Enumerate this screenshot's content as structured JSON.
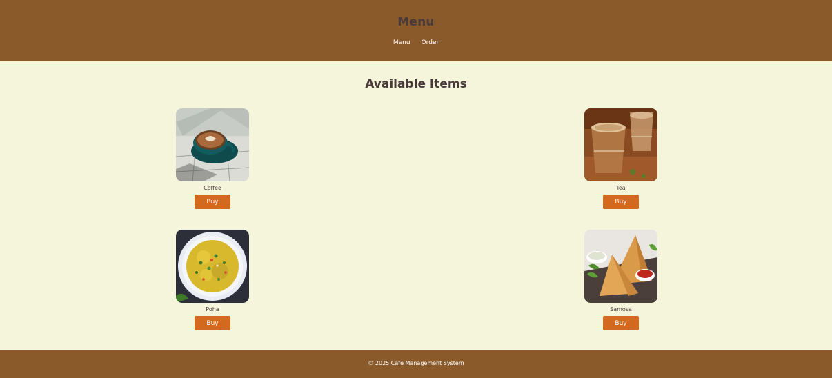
{
  "header": {
    "title": "Menu",
    "nav": [
      {
        "label": "Menu"
      },
      {
        "label": "Order"
      }
    ]
  },
  "main": {
    "section_title": "Available Items",
    "items": [
      {
        "name": "Coffee",
        "buy_label": "Buy",
        "image": "coffee-cup-photo"
      },
      {
        "name": "Tea",
        "buy_label": "Buy",
        "image": "chai-glasses-photo"
      },
      {
        "name": "Poha",
        "buy_label": "Buy",
        "image": "poha-plate-photo"
      },
      {
        "name": "Samosa",
        "buy_label": "Buy",
        "image": "samosa-plate-photo"
      }
    ]
  },
  "footer": {
    "text": "© 2025 Cafe Management System"
  },
  "colors": {
    "header_bg": "#8b5a2b",
    "page_bg": "#f5f5dc",
    "button_bg": "#d2691e",
    "heading_text": "#4a3b3b"
  }
}
